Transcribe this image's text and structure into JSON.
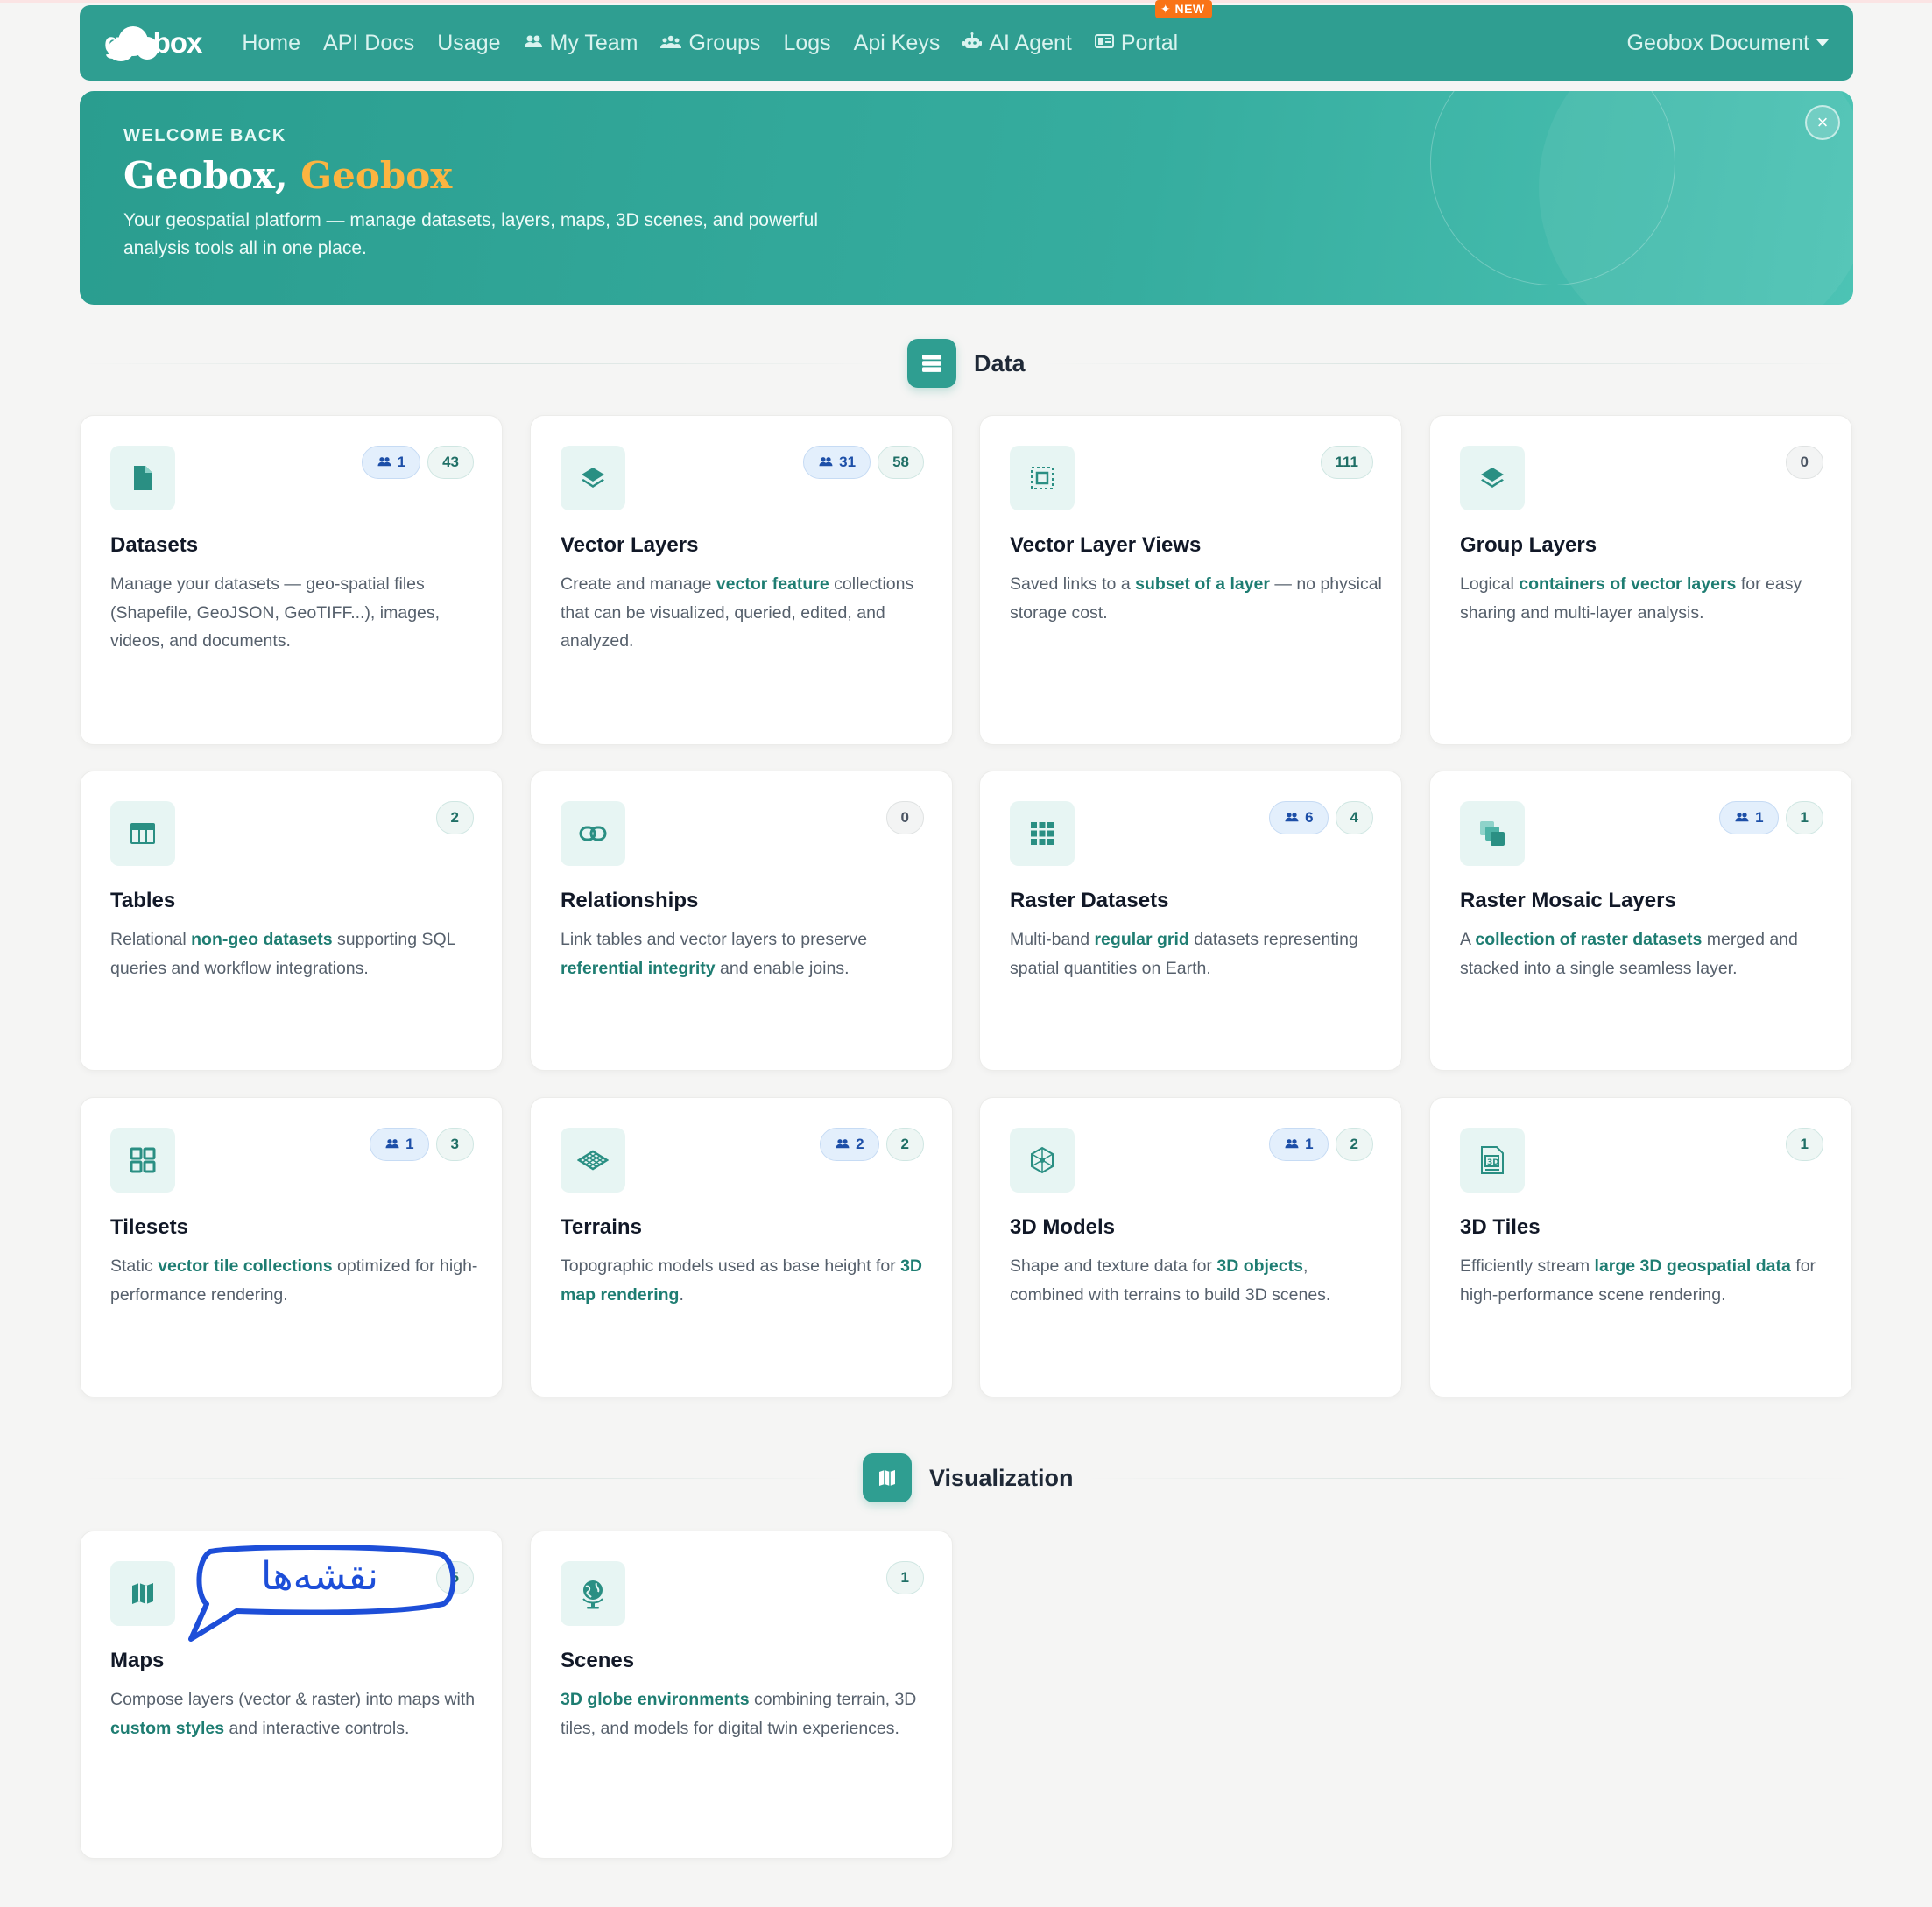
{
  "nav": {
    "logo": "geobox",
    "items": [
      {
        "label": "Home",
        "icon": ""
      },
      {
        "label": "API Docs",
        "icon": ""
      },
      {
        "label": "Usage",
        "icon": ""
      },
      {
        "label": "My Team",
        "icon": "people-icon"
      },
      {
        "label": "Groups",
        "icon": "groups-icon"
      },
      {
        "label": "Logs",
        "icon": ""
      },
      {
        "label": "Api Keys",
        "icon": ""
      },
      {
        "label": "AI Agent",
        "icon": "robot-icon"
      },
      {
        "label": "Portal",
        "icon": "portal-icon",
        "badge": "NEW"
      }
    ],
    "account": "Geobox Document"
  },
  "hero": {
    "eyebrow": "WELCOME BACK",
    "name_first": "Geobox,",
    "name_second": "Geobox",
    "description": "Your geospatial platform — manage datasets, layers, maps, 3D scenes, and powerful analysis tools all in one place.",
    "close": "×"
  },
  "sections": {
    "data": "Data",
    "visualization": "Visualization"
  },
  "cards": [
    {
      "title": "Datasets",
      "team": "1",
      "count": "43",
      "desc": [
        "Manage your datasets — geo-spatial files (Shapefile, GeoJSON, GeoTIFF...), images, videos, and documents."
      ]
    },
    {
      "title": "Vector Layers",
      "team": "31",
      "count": "58",
      "desc": [
        "Create and manage ",
        "vector feature",
        " collections that can be visualized, queried, edited, and analyzed."
      ]
    },
    {
      "title": "Vector Layer Views",
      "team": "",
      "count": "111",
      "desc": [
        "Saved links to a ",
        "subset of a layer",
        " — no physical storage cost."
      ]
    },
    {
      "title": "Group Layers",
      "team": "",
      "count": "0",
      "desc": [
        "Logical ",
        "containers of vector layers",
        " for easy sharing and multi-layer analysis."
      ]
    },
    {
      "title": "Tables",
      "team": "",
      "count": "2",
      "desc": [
        "Relational ",
        "non-geo datasets",
        " supporting SQL queries and workflow integrations."
      ]
    },
    {
      "title": "Relationships",
      "team": "",
      "count": "0",
      "desc": [
        "Link tables and vector layers to preserve ",
        "referential integrity",
        " and enable joins."
      ]
    },
    {
      "title": "Raster Datasets",
      "team": "6",
      "count": "4",
      "desc": [
        "Multi-band ",
        "regular grid",
        " datasets representing spatial quantities on Earth."
      ]
    },
    {
      "title": "Raster Mosaic Layers",
      "team": "1",
      "count": "1",
      "desc": [
        "A ",
        "collection of raster datasets",
        " merged and stacked into a single seamless layer."
      ]
    },
    {
      "title": "Tilesets",
      "team": "1",
      "count": "3",
      "desc": [
        "Static ",
        "vector tile collections",
        " optimized for high-performance rendering."
      ]
    },
    {
      "title": "Terrains",
      "team": "2",
      "count": "2",
      "desc": [
        "Topographic models used as base height for ",
        "3D map rendering",
        "."
      ]
    },
    {
      "title": "3D Models",
      "team": "1",
      "count": "2",
      "desc": [
        "Shape and texture data for ",
        "3D objects",
        ", combined with terrains to build 3D scenes."
      ]
    },
    {
      "title": "3D Tiles",
      "team": "",
      "count": "1",
      "desc": [
        "Efficiently stream ",
        "large 3D geospatial data",
        " for high-performance scene rendering."
      ]
    },
    {
      "title": "Maps",
      "team": "",
      "count": "5",
      "desc": [
        "Compose layers (vector & raster) into maps with ",
        "custom styles",
        " and interactive controls."
      ]
    },
    {
      "title": "Scenes",
      "team": "",
      "count": "1",
      "desc": [
        "",
        "3D globe environments",
        " combining terrain, 3D tiles, and models for digital twin experiences."
      ]
    }
  ],
  "annotation": "نقشه‌ها",
  "colors": {
    "primary": "#2f9e91",
    "accent": "#fcb440",
    "annotation": "#1d4ed8"
  }
}
